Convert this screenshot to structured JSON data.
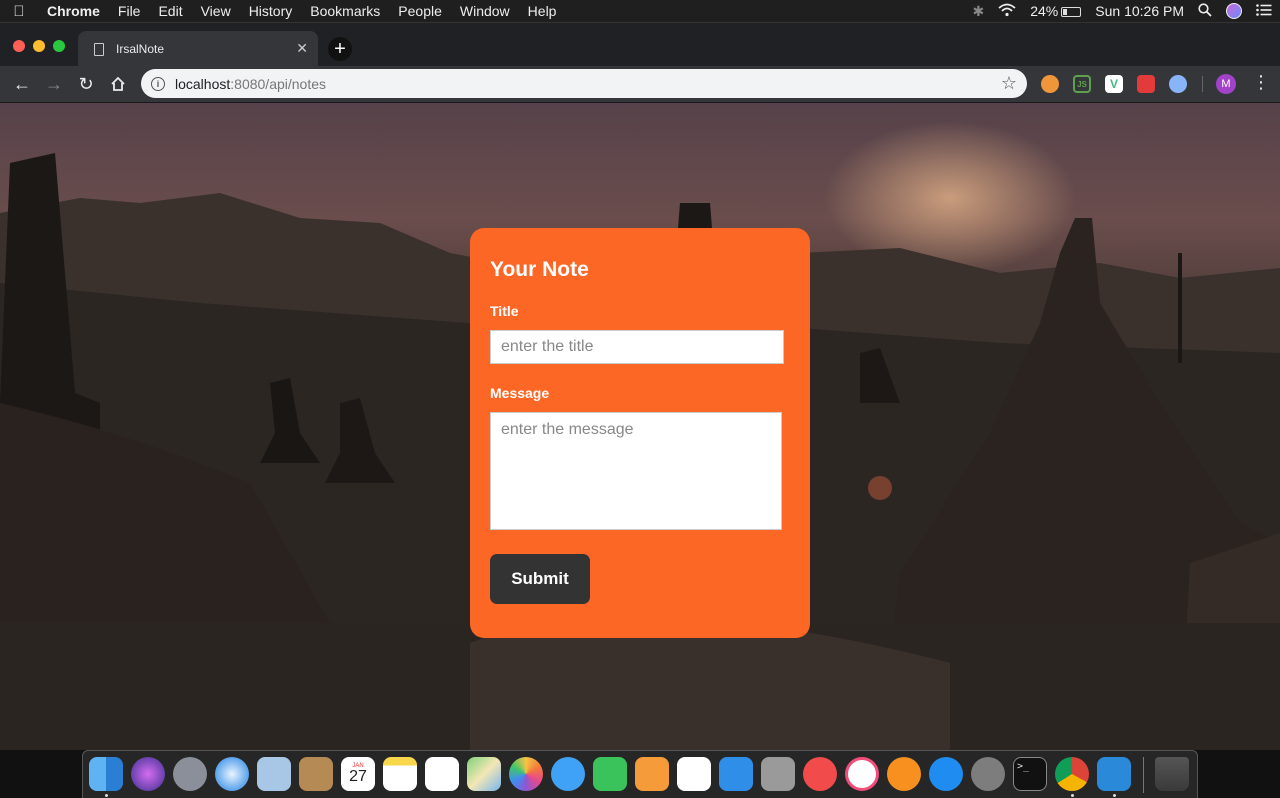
{
  "menubar": {
    "app_name": "Chrome",
    "items": [
      "File",
      "Edit",
      "View",
      "History",
      "Bookmarks",
      "People",
      "Window",
      "Help"
    ],
    "battery_percent": "24%",
    "clock": "Sun 10:26 PM"
  },
  "browser": {
    "tab_title": "IrsalNote",
    "url_host": "localhost",
    "url_path": ":8080/api/notes",
    "profile_initial": "M"
  },
  "note_form": {
    "heading": "Your Note",
    "title_label": "Title",
    "title_placeholder": "enter the title",
    "message_label": "Message",
    "message_placeholder": "enter the message",
    "submit_label": "Submit"
  },
  "colors": {
    "card_accent": "#fd6725",
    "submit_button": "#333333"
  },
  "extensions": [
    "metamask-icon",
    "nodejs-icon",
    "vue-devtools-icon",
    "redux-icon",
    "extension-icon"
  ],
  "dock": [
    "finder",
    "siri",
    "launchpad",
    "safari",
    "mail-bird",
    "contacts",
    "calendar",
    "notes",
    "reminders",
    "maps",
    "photos",
    "messages",
    "facetime",
    "pages",
    "numbers",
    "keynote",
    "calculator",
    "news",
    "music",
    "books",
    "app-store",
    "system-preferences",
    "terminal",
    "chrome",
    "vscode",
    "trash"
  ],
  "dock_calendar_day": "27",
  "dock_calendar_month": "JAN"
}
